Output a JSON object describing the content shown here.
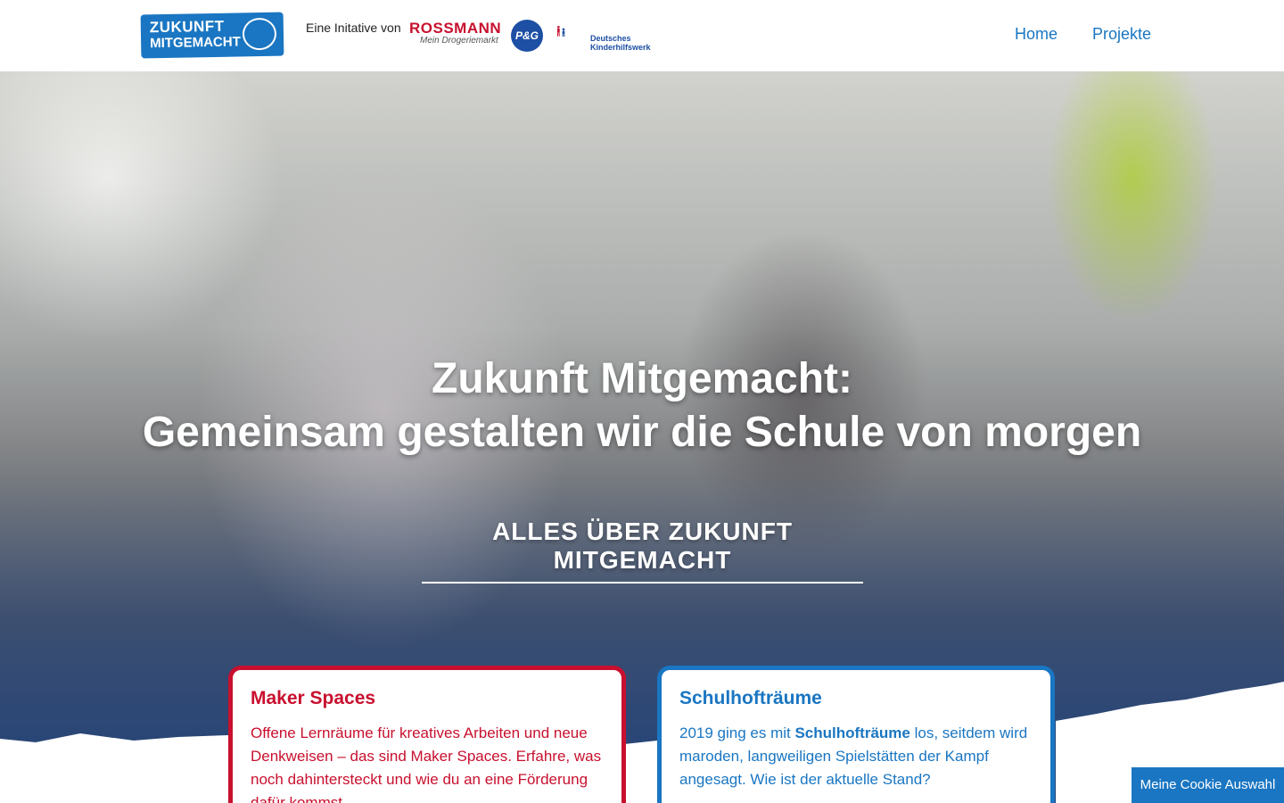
{
  "header": {
    "logo_line1": "ZUKUNFT",
    "logo_line2": "MITGEMACHT",
    "initiative_label": "Eine Initative von",
    "partners": {
      "rossmann": "ROSSMANN",
      "rossmann_sub": "Mein Drogeriemarkt",
      "pg": "P&G",
      "dkhw_line1": "Deutsches",
      "dkhw_line2": "Kinderhilfswerk"
    },
    "nav": [
      "Home",
      "Projekte"
    ]
  },
  "hero": {
    "title_line1": "Zukunft Mitgemacht:",
    "title_line2": "Gemeinsam gestalten wir die Schule von morgen",
    "cta": "ALLES ÜBER ZUKUNFT MITGEMACHT"
  },
  "cards": [
    {
      "title": "Maker Spaces",
      "text": "Offene Lernräume für kreatives Arbeiten und neue Denkweisen – das sind Maker Spaces.  Erfahre, was noch dahintersteckt und wie du an eine Förderung dafür kommst."
    },
    {
      "title": "Schulhofträume",
      "text_before": "2019 ging es mit ",
      "text_bold": "Schulhofträume",
      "text_after": " los, seitdem wird maroden, langweiligen Spielstätten der Kampf angesagt. Wie ist der aktuelle Stand?"
    }
  ],
  "cookie_button": "Meine Cookie Auswahl",
  "colors": {
    "brand_blue": "#1a76c2",
    "brand_red": "#c8102e"
  }
}
